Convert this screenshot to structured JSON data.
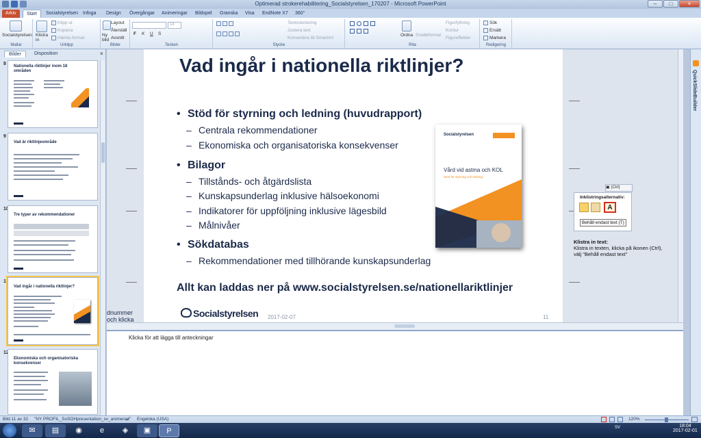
{
  "window": {
    "title": "Optimerad strokerehabilitering_Socialstyrelsen_170207 - Microsoft PowerPoint",
    "min": "–",
    "max": "□",
    "close": "×"
  },
  "tabs": [
    "Arkiv",
    "Start",
    "Socialstyrelsen",
    "Infoga",
    "Design",
    "Övergångar",
    "Animeringar",
    "Bildspel",
    "Granska",
    "Visa",
    "EndNote X7",
    "360°"
  ],
  "ribbon": {
    "groups": [
      "Mallar",
      "Urklipp",
      "Bilder",
      "Tecken",
      "Stycke",
      "Rita",
      "Redigering"
    ],
    "mallar": {
      "label": "Socialstyrelsen"
    },
    "urklipp": {
      "paste": "Klistra in",
      "cut": "Klipp ut",
      "copy": "Kopiera",
      "format": "Hämta format"
    },
    "bilder": {
      "new": "Ny bild",
      "layout": "Layout",
      "reset": "Återställ",
      "section": "Avsnitt"
    },
    "tecken": {
      "fontsize": "14",
      "bold": "F",
      "italic": "K",
      "underline": "U",
      "strike": "S"
    },
    "stycke": {
      "direction": "Textorientering",
      "align": "Justera text",
      "smartart": "Konvertera till SmartArt"
    },
    "rita": {
      "arrange": "Ordna",
      "quick": "Snabbformat",
      "fill": "Figurfyllning",
      "outline": "Kontur",
      "effects": "Figureffekter"
    },
    "redigering": {
      "find": "Sök",
      "replace": "Ersätt",
      "select": "Markera"
    }
  },
  "leftpanel": {
    "tab_slides": "Bilder",
    "tab_outline": "Disposition",
    "close": "×"
  },
  "thumbs": [
    {
      "num": "8",
      "title": "Nationella riktlinjer inom 18 områden"
    },
    {
      "num": "9",
      "title": "Vad är riktlinjeområde"
    },
    {
      "num": "10",
      "title": "Tre typer av rekommendationer"
    },
    {
      "num": "11",
      "title": "Vad ingår i nationella riktlinjer?"
    },
    {
      "num": "12",
      "title": "Ekonomiska och organisatoriska konsekvenser"
    }
  ],
  "slide": {
    "title": "Vad ingår i nationella riktlinjer?",
    "bullets": [
      {
        "text": "Stöd för styrning och ledning (huvudrapport)",
        "subs": [
          "Centrala rekommendationer",
          "Ekonomiska och organisatoriska konsekvenser"
        ]
      },
      {
        "text": "Bilagor",
        "subs": [
          "Tillstånds- och åtgärdslista",
          "Kunskapsunderlag inklusive hälsoekonomi",
          "Indikatorer för uppföljning inklusive lägesbild",
          "Målnivåer"
        ]
      },
      {
        "text": "Sökdatabas",
        "subs": [
          "Rekommendationer med tillhörande kunskapsunderlag"
        ]
      }
    ],
    "footer": "Allt kan laddas ner på www.socialstyrelsen.se/nationellariktlinjer",
    "logo": "Socialstyrelsen",
    "date": "2017-02-07",
    "page": "11",
    "cover": {
      "logo": "Socialstyrelsen",
      "title": "Vård vid astma och KOL",
      "subtitle": "Stöd för styrning och ledning"
    }
  },
  "offslide": {
    "line1": "dnummer",
    "line2": "och klicka"
  },
  "paste_popup": {
    "ctrl": "(Ctrl)",
    "header": "Inklistringsalternativ:",
    "tooltip": "Behåll endast text (T)",
    "note_title": "Klistra in text:",
    "note_body": "Klistra in texten, klicka på ikonen (Ctrl), välj \"Behåll endast text\""
  },
  "notes": {
    "placeholder": "Klicka för att lägga till anteckningar"
  },
  "rightpane": {
    "label": "QuickSlideBuilder"
  },
  "status": {
    "slide": "Bild 11 av 32",
    "theme": "\"NY PROFIL_SoSOHpresentation_sv_animerad\"",
    "lang": "Engelska (USA)",
    "zoom": "120%"
  },
  "taskbar": {
    "lang": "SV",
    "time": "18:04",
    "date": "2017-02-01"
  },
  "colors": {
    "navy": "#1b2a4a",
    "orange": "#f29222",
    "ribbon": "#dbe6f4",
    "file_tab": "#c8502f"
  }
}
